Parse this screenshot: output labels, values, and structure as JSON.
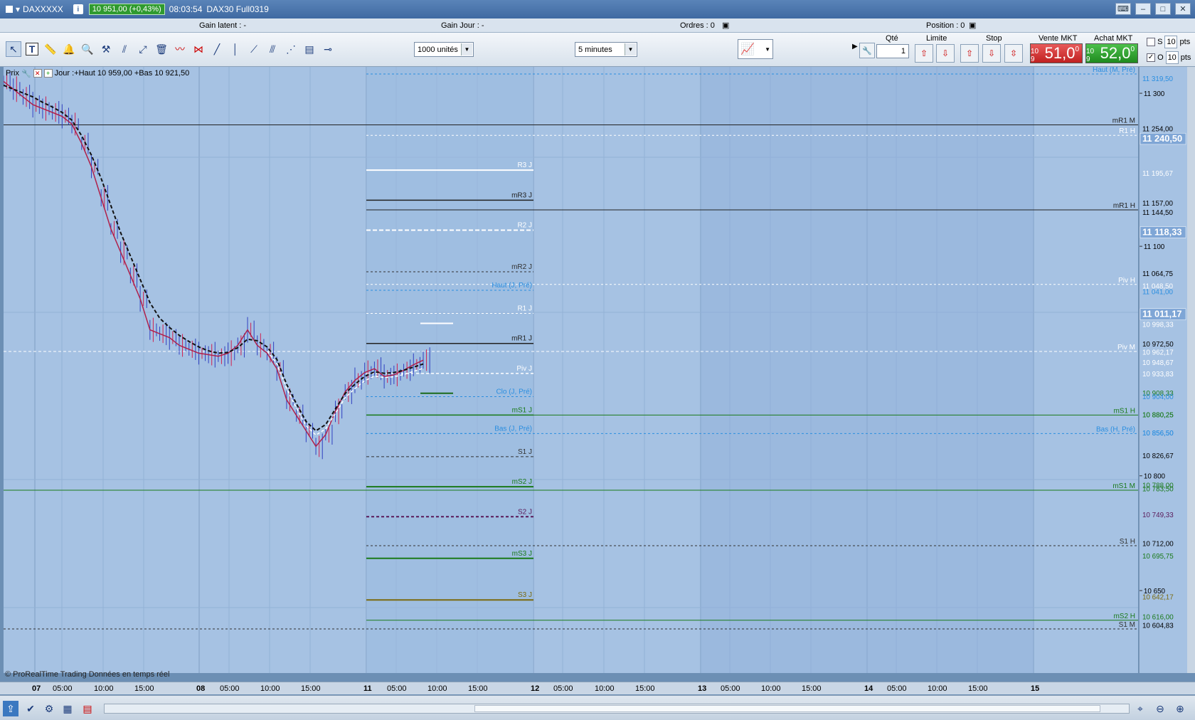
{
  "titlebar": {
    "symbol": "DAXXXXX",
    "price_box": "10 951,00 (+0,43%)",
    "time": "08:03:54",
    "contract": "DAX30 Full0319"
  },
  "status": {
    "gain_latent": "Gain latent : -",
    "gain_jour": "Gain Jour : -",
    "ordres": "Ordres : 0",
    "position": "Position : 0"
  },
  "toolbar": {
    "units": "1000 unités",
    "period": "5 minutes"
  },
  "trade": {
    "qte_label": "Qté",
    "qte_value": "1",
    "limite_label": "Limite",
    "stop_label": "Stop",
    "vente_label": "Vente MKT",
    "achat_label": "Achat MKT",
    "vente_small": "10 9",
    "vente_big": "51,0",
    "vente_sup": "0",
    "achat_small": "10 9",
    "achat_big": "52,0",
    "achat_sup": "0",
    "s_label": "S",
    "o_label": "O",
    "s_pts": "10",
    "o_pts": "10",
    "pts": "pts"
  },
  "legend": {
    "prix": "Prix",
    "jour": "Jour :+Haut 10 959,00 +Bas 10 921,50"
  },
  "copyright": "© ProRealTime Trading Données en temps réel",
  "price_axis": {
    "ticks": [
      "11 300",
      "11 100",
      "10 800",
      "10 650"
    ],
    "labels": [
      {
        "text": "11 319,50",
        "color": "#2a8ee0"
      },
      {
        "text": "11 254,00",
        "color": "#000"
      },
      {
        "text": "11 240,50",
        "color": "#fff",
        "big": true
      },
      {
        "text": "11 195,67",
        "color": "#fff"
      },
      {
        "text": "11 157,00",
        "color": "#000"
      },
      {
        "text": "11 144,50",
        "color": "#000"
      },
      {
        "text": "11 118,33",
        "color": "#fff",
        "big": true
      },
      {
        "text": "11 064,75",
        "color": "#000"
      },
      {
        "text": "11 048,50",
        "color": "#fff"
      },
      {
        "text": "11 041,00",
        "color": "#2a8ee0"
      },
      {
        "text": "11 011,17",
        "color": "#fff",
        "big": true
      },
      {
        "text": "10 998,33",
        "color": "#fff"
      },
      {
        "text": "10 972,50",
        "color": "#000"
      },
      {
        "text": "10 962,17",
        "color": "#fff"
      },
      {
        "text": "10 948,67",
        "color": "#fff"
      },
      {
        "text": "10 933,83",
        "color": "#fff"
      },
      {
        "text": "10 908,33",
        "color": "#1a7a1a"
      },
      {
        "text": "10 904,00",
        "color": "#2a8ee0"
      },
      {
        "text": "10 880,25",
        "color": "#1a7a1a"
      },
      {
        "text": "10 880,25",
        "color": "#1a7a1a"
      },
      {
        "text": "10 856,50",
        "color": "#2a8ee0"
      },
      {
        "text": "10 856,50",
        "color": "#2a8ee0"
      },
      {
        "text": "10 826,67",
        "color": "#000"
      },
      {
        "text": "10 788,00",
        "color": "#1a7a1a"
      },
      {
        "text": "10 783,50",
        "color": "#1a7a1a"
      },
      {
        "text": "10 749,33",
        "color": "#5a1a5a"
      },
      {
        "text": "10 712,00",
        "color": "#000"
      },
      {
        "text": "10 695,75",
        "color": "#1a7a1a"
      },
      {
        "text": "10 642,17",
        "color": "#7a6a10"
      },
      {
        "text": "10 616,00",
        "color": "#1a7a1a"
      },
      {
        "text": "10 604,83",
        "color": "#000"
      }
    ]
  },
  "levels_right": [
    "Haut (M, Pré)",
    "mR1 M",
    "R1 H",
    "mR1 H",
    "Piv H",
    "Piv M",
    "mS1 H",
    "Bas (H, Pré)",
    "mS1 M",
    "S1 H",
    "mS2 H",
    "S1 M"
  ],
  "levels_day": [
    "R3 J",
    "mR3 J",
    "R2 J",
    "mR2 J",
    "Haut (J, Pré)",
    "R1 J",
    "mR1 J",
    "Piv J",
    "Clo (J, Pré)",
    "mS1 J",
    "Bas (J, Pré)",
    "S1 J",
    "mS2 J",
    "S2 J",
    "mS3 J",
    "S3 J"
  ],
  "time_axis": [
    {
      "t": "07",
      "day": true
    },
    {
      "t": "05:00"
    },
    {
      "t": "10:00"
    },
    {
      "t": "15:00"
    },
    {
      "t": "08",
      "day": true
    },
    {
      "t": "05:00"
    },
    {
      "t": "10:00"
    },
    {
      "t": "15:00"
    },
    {
      "t": "11",
      "day": true
    },
    {
      "t": "05:00"
    },
    {
      "t": "10:00"
    },
    {
      "t": "15:00"
    },
    {
      "t": "12",
      "day": true
    },
    {
      "t": "05:00"
    },
    {
      "t": "10:00"
    },
    {
      "t": "15:00"
    },
    {
      "t": "13",
      "day": true
    },
    {
      "t": "05:00"
    },
    {
      "t": "10:00"
    },
    {
      "t": "15:00"
    },
    {
      "t": "14",
      "day": true
    },
    {
      "t": "05:00"
    },
    {
      "t": "10:00"
    },
    {
      "t": "15:00"
    },
    {
      "t": "15",
      "day": true
    }
  ],
  "colors": {
    "bg": "#a6c2e3",
    "green": "#1a7a1a",
    "blue": "#2a8ee0",
    "sell": "#d03030",
    "buy": "#2a9a2a"
  },
  "chart_data": {
    "type": "line",
    "title": "DAX30 Full0319 5 minutes",
    "price_series": [
      11310,
      11300,
      11290,
      11280,
      11275,
      11270,
      11265,
      11255,
      11230,
      11200,
      11160,
      11120,
      11090,
      11060,
      11030,
      10990,
      10985,
      10980,
      10970,
      10965,
      10960,
      10958,
      10956,
      10960,
      10970,
      10990,
      10970,
      10960,
      10940,
      10900,
      10880,
      10860,
      10840,
      10855,
      10885,
      10910,
      10925,
      10935,
      10940,
      10930,
      10932,
      10938,
      10945,
      10951
    ],
    "ma_series": [
      11305,
      11300,
      11295,
      11290,
      11283,
      11277,
      11270,
      11260,
      11240,
      11215,
      11185,
      11150,
      11115,
      11085,
      11055,
      11025,
      11005,
      10993,
      10983,
      10975,
      10968,
      10963,
      10960,
      10961,
      10967,
      10978,
      10976,
      10968,
      10952,
      10920,
      10895,
      10872,
      10860,
      10868,
      10888,
      10908,
      10920,
      10930,
      10936,
      10934,
      10935,
      10938,
      10942,
      10946
    ]
  }
}
